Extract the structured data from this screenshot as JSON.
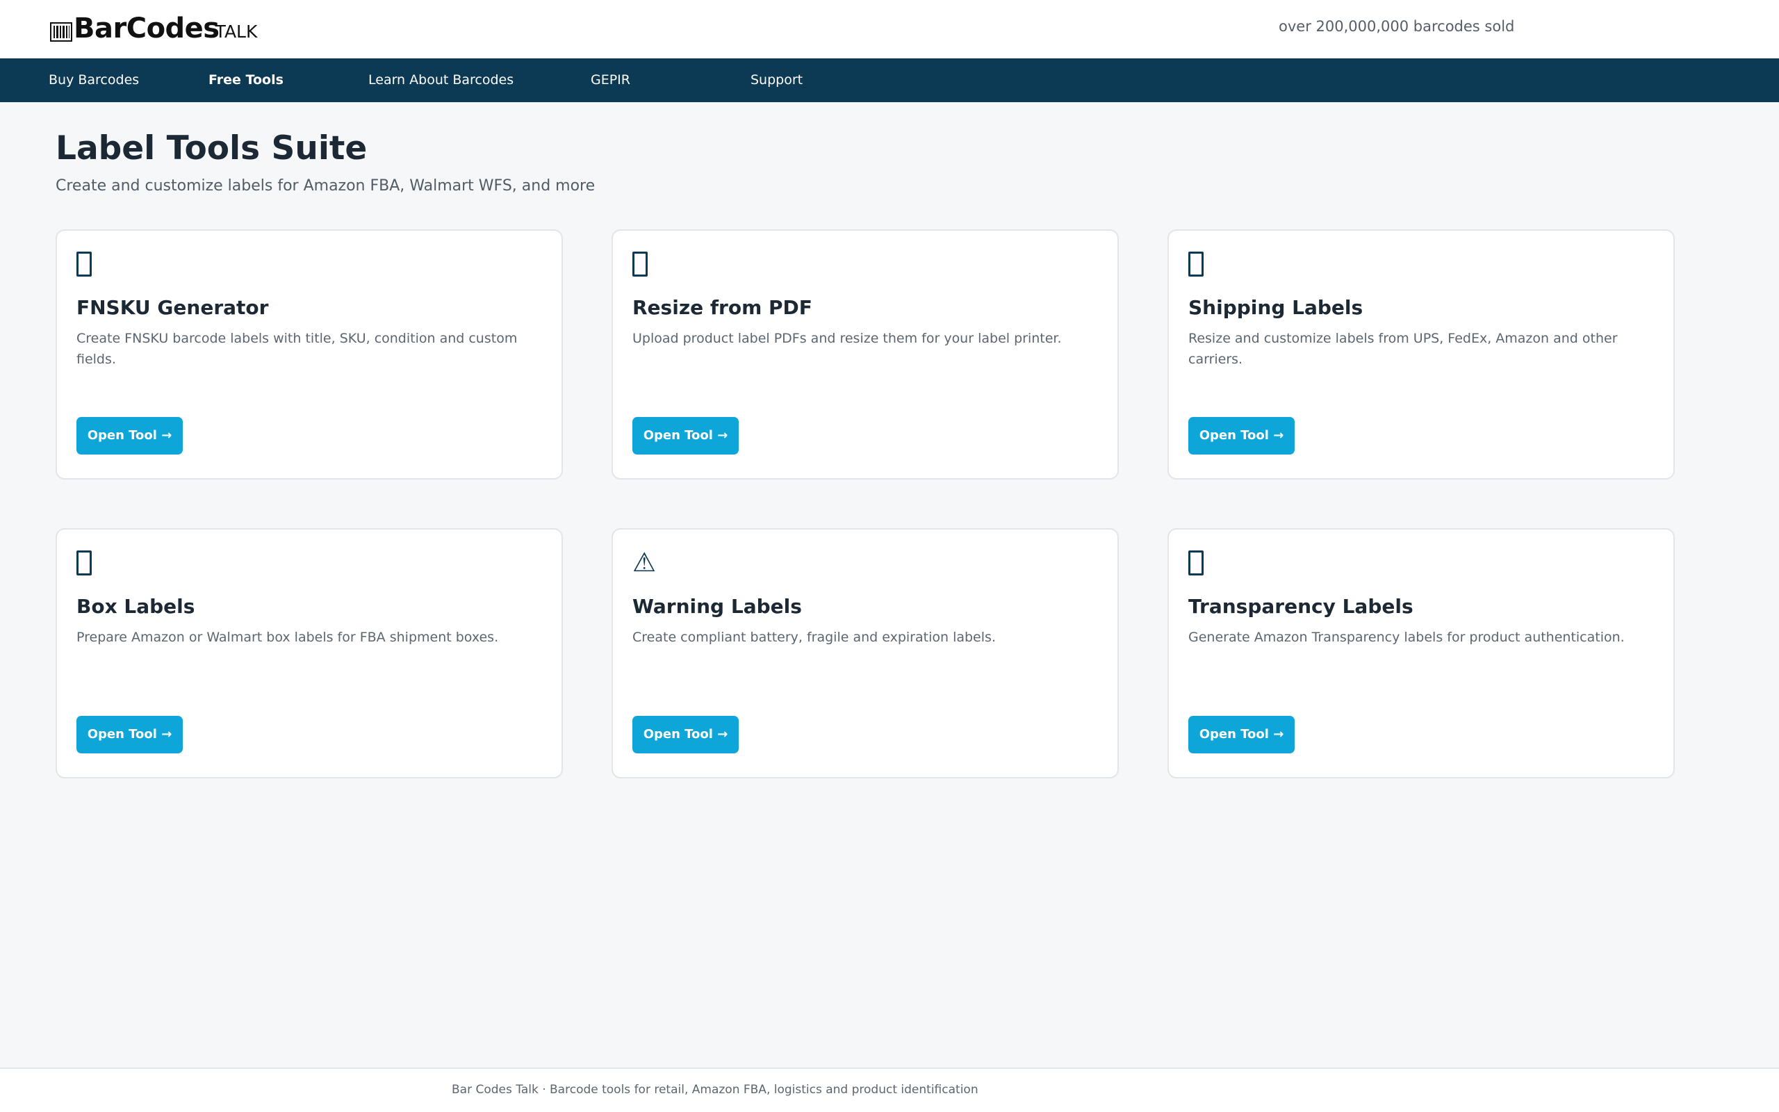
{
  "header": {
    "logo_main": "BarCodes",
    "logo_sub": "TALK",
    "sold_text": "over 200,000,000 barcodes sold"
  },
  "nav": {
    "items": [
      {
        "label": "Buy Barcodes",
        "active": false
      },
      {
        "label": "Free Tools",
        "active": true
      },
      {
        "label": "Learn About Barcodes",
        "active": false
      },
      {
        "label": "GEPIR",
        "active": false
      },
      {
        "label": "Support",
        "active": false
      }
    ]
  },
  "main": {
    "title": "Label Tools Suite",
    "subtitle": "Create and customize labels for Amazon FBA, Walmart WFS, and more",
    "cards": [
      {
        "icon": "label-icon",
        "title": "FNSKU Generator",
        "description": "Create FNSKU barcode labels with title, SKU, condition and custom fields.",
        "button": "Open Tool →"
      },
      {
        "icon": "document-icon",
        "title": "Resize from PDF",
        "description": "Upload product label PDFs and resize them for your label printer.",
        "button": "Open Tool →"
      },
      {
        "icon": "package-icon",
        "title": "Shipping Labels",
        "description": "Resize and customize labels from UPS, FedEx, Amazon and other carriers.",
        "button": "Open Tool →"
      },
      {
        "icon": "box-icon",
        "title": "Box Labels",
        "description": "Prepare Amazon or Walmart box labels for FBA shipment boxes.",
        "button": "Open Tool →"
      },
      {
        "icon": "warning-icon",
        "title": "Warning Labels",
        "description": "Create compliant battery, fragile and expiration labels.",
        "button": "Open Tool →"
      },
      {
        "icon": "shield-icon",
        "title": "Transparency Labels",
        "description": "Generate Amazon Transparency labels for product authentication.",
        "button": "Open Tool →"
      }
    ]
  },
  "footer": {
    "text": "Bar Codes Talk · Barcode tools for retail, Amazon FBA, logistics and product identification"
  },
  "colors": {
    "nav_bg": "#0c3a55",
    "accent": "#0ea5d8",
    "page_bg": "#f5f7f9"
  }
}
